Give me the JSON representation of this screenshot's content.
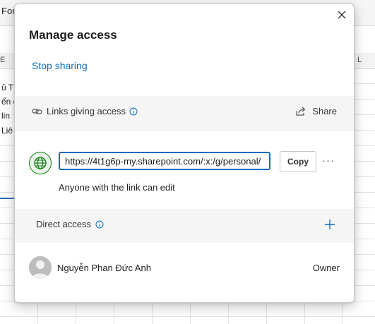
{
  "background": {
    "toolbar_text": "For",
    "col_e": "E",
    "col_l": "L",
    "cells": [
      "ủ T",
      "ển c",
      "lin",
      "Liê"
    ]
  },
  "dialog": {
    "title": "Manage access",
    "stop_sharing": "Stop sharing",
    "links_section": {
      "label": "Links giving access",
      "info_icon": "info-icon",
      "share_label": "Share",
      "share_icon": "share-icon"
    },
    "link": {
      "icon": "globe-icon",
      "url": "https://4t1g6p-my.sharepoint.com/:x:/g/personal/",
      "copy_label": "Copy",
      "more_label": "···",
      "permission_text": "Anyone with the link can edit"
    },
    "direct_access": {
      "label": "Direct access",
      "info_icon": "info-icon",
      "add_icon": "plus-icon"
    },
    "people": [
      {
        "name": "Nguyễn Phan Đức Anh",
        "role": "Owner"
      }
    ]
  },
  "colors": {
    "accent": "#0f6cbd",
    "globe_green": "#107c10",
    "section_bg": "#f5f5f5"
  }
}
